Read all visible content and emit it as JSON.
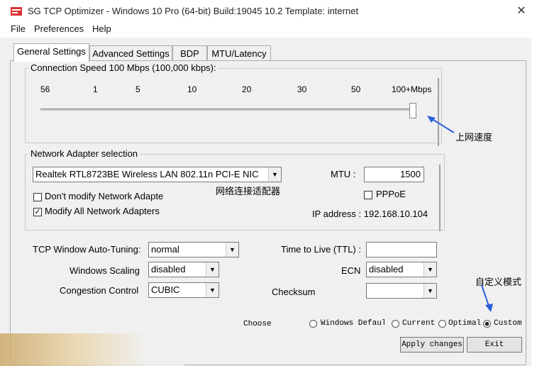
{
  "window": {
    "title": "SG TCP Optimizer - Windows 10 Pro (64-bit) Build:19045 10.2  Template: internet",
    "close_glyph": "✕"
  },
  "menu": [
    "File",
    "Preferences",
    "Help"
  ],
  "tabs": [
    "General Settings",
    "Advanced Settings",
    "BDP",
    "MTU/Latency"
  ],
  "connection_speed": {
    "label": "Connection Speed  100 Mbps (100,000 kbps):",
    "ticks": [
      "56",
      "1",
      "5",
      "10",
      "20",
      "30",
      "50",
      "100+Mbps"
    ],
    "annotation": "上网速度"
  },
  "adapter": {
    "group_label": "Network Adapter selection",
    "selected": "Realtek RTL8723BE Wireless LAN 802.11n PCI-E NIC",
    "annotation": "网络连接适配器",
    "mtu_label": "MTU :",
    "mtu_value": "1500",
    "pppoe_label": "PPPoE",
    "dont_modify_label": "Don't modify Network Adapte",
    "modify_all_label": "Modify All Network Adapters",
    "modify_all_checked": "✓",
    "ip_label": "IP address : 192.168.10.104"
  },
  "settings": {
    "tcp_window_label": "TCP Window Auto-Tuning:",
    "tcp_window_value": "normal",
    "windows_scaling_label": "Windows Scaling",
    "windows_scaling_value": "disabled",
    "congestion_label": "Congestion Control",
    "congestion_value": "CUBIC",
    "ttl_label": "Time to Live (TTL) :",
    "ttl_value": "",
    "ecn_label": "ECN",
    "ecn_value": "disabled",
    "checksum_label": "Checksum",
    "checksum_value": ""
  },
  "choose": {
    "label": "Choose",
    "options": [
      "Windows Default",
      "Current",
      "Optimal",
      "Custom"
    ],
    "annotation": "自定义模式"
  },
  "buttons": {
    "apply": "Apply changes",
    "exit": "Exit"
  },
  "colors": {
    "annotation_arrow": "#2b5fd9"
  }
}
